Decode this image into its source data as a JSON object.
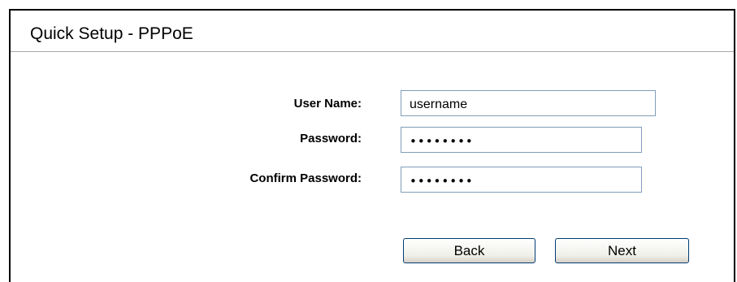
{
  "header": {
    "title": "Quick Setup - PPPoE"
  },
  "form": {
    "user_name_label": "User Name:",
    "user_name_value": "username",
    "password_label": "Password:",
    "password_value": "password",
    "confirm_password_label": "Confirm Password:",
    "confirm_password_value": "password"
  },
  "buttons": {
    "back_label": "Back",
    "next_label": "Next"
  }
}
